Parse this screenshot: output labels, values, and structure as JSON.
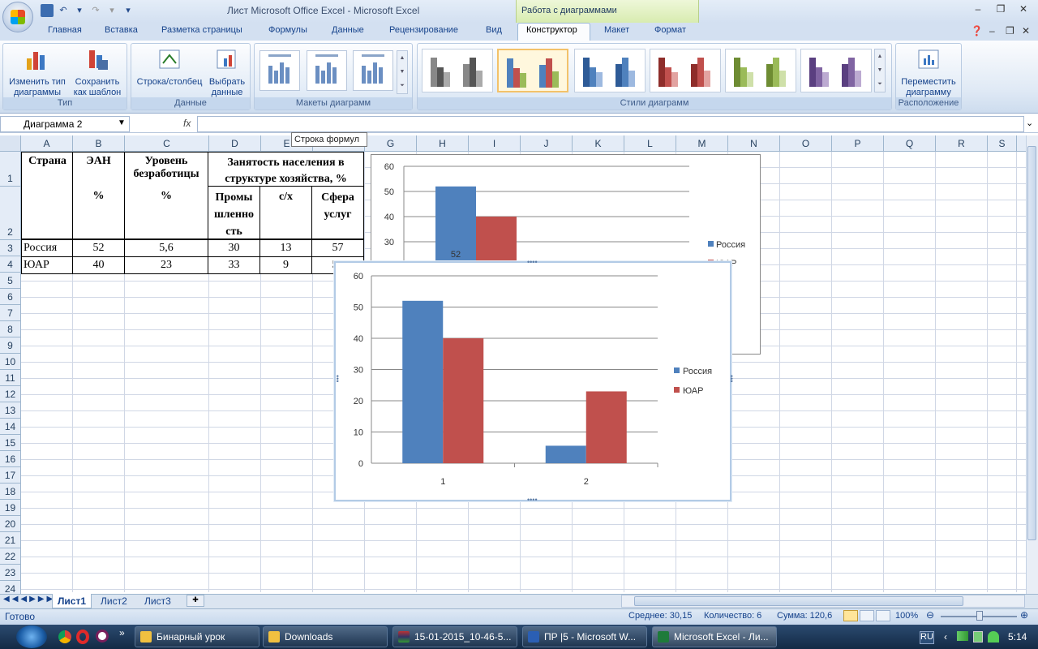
{
  "window": {
    "title": "Лист Microsoft Office Excel - Microsoft Excel",
    "context_group": "Работа с диаграммами"
  },
  "ribbon_tabs": [
    "Главная",
    "Вставка",
    "Разметка страницы",
    "Формулы",
    "Данные",
    "Рецензирование",
    "Вид",
    "Конструктор",
    "Макет",
    "Формат"
  ],
  "ribbon": {
    "type_group": {
      "label": "Тип",
      "btn1": "Изменить тип диаграммы",
      "btn1a": "Изменить тип",
      "btn1b": "диаграммы",
      "btn2a": "Сохранить",
      "btn2b": "как шаблон"
    },
    "data_group": {
      "label": "Данные",
      "btn1": "Строка/столбец",
      "btn2a": "Выбрать",
      "btn2b": "данные"
    },
    "layouts_group": {
      "label": "Макеты диаграмм"
    },
    "styles_group": {
      "label": "Стили диаграмм"
    },
    "location_group": {
      "label": "Расположение",
      "btn1a": "Переместить",
      "btn1b": "диаграмму"
    }
  },
  "formula_bar": {
    "name_box": "Диаграмма 2",
    "fx": "fx",
    "tooltip": "Строка формул"
  },
  "columns": [
    "A",
    "B",
    "C",
    "D",
    "E",
    "F",
    "G",
    "H",
    "I",
    "J",
    "K",
    "L",
    "M",
    "N",
    "O",
    "P",
    "Q",
    "R",
    "S"
  ],
  "rows": [
    "1",
    "2",
    "3",
    "4",
    "5",
    "6",
    "7",
    "8",
    "9",
    "10",
    "11",
    "12",
    "13",
    "14",
    "15",
    "16",
    "17",
    "18",
    "19",
    "20",
    "21",
    "22",
    "23",
    "24"
  ],
  "table": {
    "h_country": "Страна",
    "h_ean": "ЭАН",
    "h_unemp": "Уровень безработицы",
    "h_employ": "Занятость населения в структуре хозяйства, %",
    "h_pct1": "%",
    "h_pct2": "%",
    "h_ind": "Промышленность",
    "h_ind_lines": [
      "Промы",
      "шленно",
      "сть"
    ],
    "h_agr": "с/х",
    "h_serv_lines": [
      "Сфера",
      "услуг"
    ],
    "r1": [
      "Россия",
      "52",
      "5,6",
      "30",
      "13",
      "57"
    ],
    "r2": [
      "ЮАР",
      "40",
      "23",
      "33",
      "9",
      "58"
    ]
  },
  "chart_data": [
    {
      "type": "bar",
      "categories": [
        "1",
        "2"
      ],
      "series": [
        {
          "name": "Россия",
          "values": [
            52,
            5.6
          ]
        },
        {
          "name": "ЮАР",
          "values": [
            40,
            23
          ]
        }
      ],
      "yticks": [
        "60",
        "50",
        "40",
        "30",
        "20",
        "10",
        "0"
      ],
      "ylim": [
        0,
        60
      ],
      "legend": "right"
    },
    {
      "type": "bar",
      "visible_yticks": [
        "60",
        "50",
        "40",
        "30"
      ],
      "visible_label": "52",
      "legend": [
        "Россия",
        "ЮАР"
      ],
      "colors": [
        "#4f81bd",
        "#c0504d"
      ]
    }
  ],
  "sheets": [
    "Лист1",
    "Лист2",
    "Лист3"
  ],
  "status": {
    "ready": "Готово",
    "avg": "Среднее: 30,15",
    "count": "Количество: 6",
    "sum": "Сумма: 120,6",
    "zoom": "100%"
  },
  "taskbar": {
    "items": [
      "Бинарный урок",
      "Downloads",
      "15-01-2015_10-46-5...",
      "ПР |5 - Microsoft W...",
      "Microsoft Excel - Ли..."
    ],
    "lang": "RU",
    "time": "5:14"
  },
  "colors": {
    "russia": "#4f81bd",
    "sar": "#c0504d"
  }
}
